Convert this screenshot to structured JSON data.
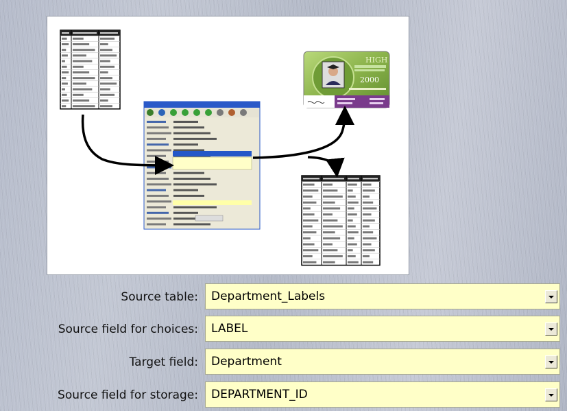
{
  "form": {
    "source_table": {
      "label": "Source table:",
      "value": "Department_Labels",
      "icon": "dropdown-arrow-icon"
    },
    "source_field_choices": {
      "label": "Source field for choices:",
      "value": "LABEL",
      "icon": "dropdown-arrow-icon"
    },
    "target_field": {
      "label": "Target field:",
      "value": "Department",
      "icon": "dropdown-arrow-icon"
    },
    "source_field_storage": {
      "label": "Source field for storage:",
      "value": "DEPARTMENT_ID",
      "icon": "dropdown-arrow-icon"
    }
  },
  "illustration": {
    "card_header": "HIGH",
    "card_year": "2000"
  },
  "colors": {
    "field_bg": "#ffffc8",
    "card_green": "#8ab24a",
    "card_purple": "#7a3b8c",
    "app_title_blue": "#2a59c8"
  }
}
